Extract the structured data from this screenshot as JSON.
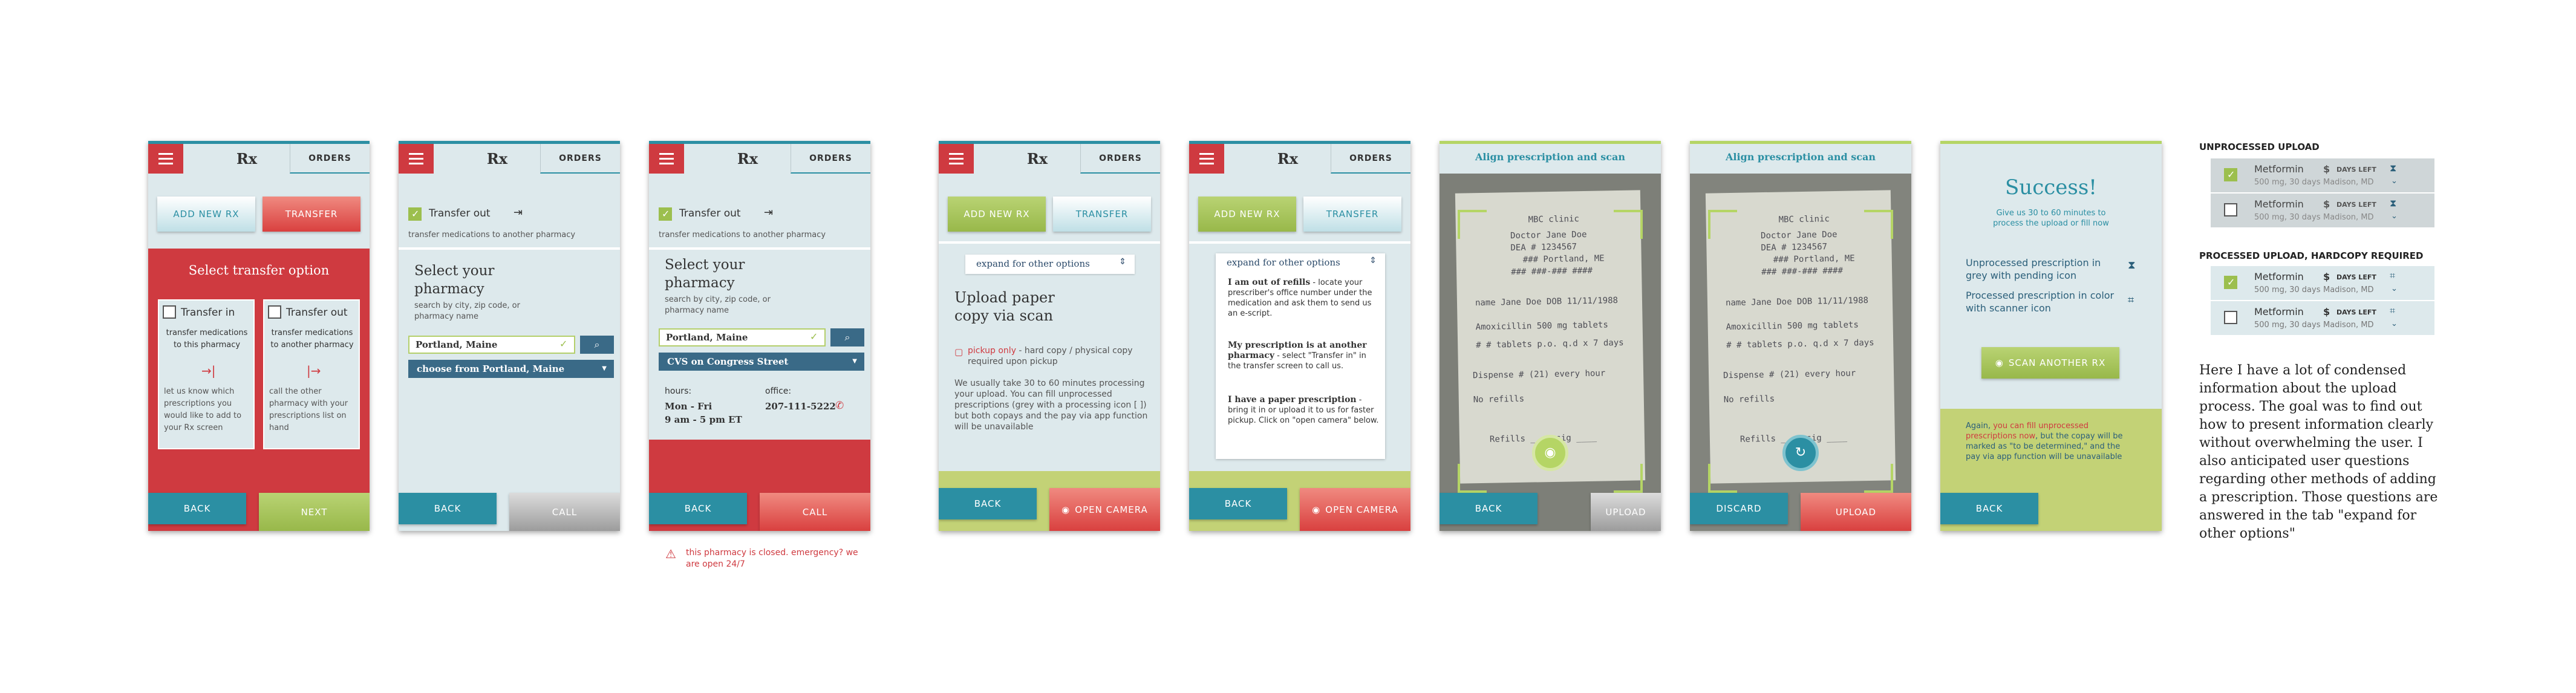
{
  "common": {
    "rx_title": "Rx",
    "orders_tab": "ORDERS"
  },
  "screen1": {
    "add_new_rx": "ADD NEW RX",
    "transfer": "TRANSFER",
    "title": "Select transfer option",
    "in_label": "Transfer in",
    "in_sub": "transfer medications to this pharmacy",
    "in_desc": "let us know which prescriptions you would like to add to your Rx screen",
    "out_label": "Transfer out",
    "out_sub": "transfer medications to another pharmacy",
    "out_desc": "call the other pharmacy with your prescriptions list on hand",
    "back": "BACK",
    "next": "NEXT"
  },
  "screen2": {
    "transfer_out": "Transfer out",
    "sub": "transfer medications to another pharmacy",
    "heading": "Select your pharmacy",
    "hint": "search by city, zip code, or pharmacy name",
    "search_value": "Portland, Maine",
    "choose": "choose from Portland, Maine",
    "back": "BACK",
    "call": "CALL"
  },
  "screen3": {
    "transfer_out": "Transfer out",
    "sub": "transfer medications to another pharmacy",
    "heading": "Select your pharmacy",
    "hint": "search by city, zip code, or pharmacy name",
    "search_value": "Portland, Maine",
    "pharmacy": "CVS on Congress Street",
    "hours_label": "hours:",
    "hours_days": "Mon - Fri",
    "hours_time": "9 am - 5 pm ET",
    "office_label": "office:",
    "office_phone": "207-111-5222",
    "back": "BACK",
    "call": "CALL",
    "warning": "this pharmacy is closed. emergency? we are open 24/7"
  },
  "screen4": {
    "add_new_rx": "ADD NEW RX",
    "transfer": "TRANSFER",
    "expand": "expand for other options",
    "heading": "Upload paper copy via scan",
    "pickup": "pickup only",
    "pickup_desc": " - hard copy / physical copy required upon pickup",
    "body": "We usually take 30 to 60 minutes processing your upload. You can fill unprocessed prescriptions (grey with a processing icon [ ]) but both copays and the pay via app function will be unavailable",
    "back": "BACK",
    "open_camera": "OPEN CAMERA"
  },
  "screen5": {
    "add_new_rx": "ADD NEW RX",
    "transfer": "TRANSFER",
    "expand": "expand for other options",
    "opt1_title": "I am out of refills",
    "opt1_body": " - locate your prescriber's office number under the medication and ask them to send us an e-script.",
    "opt2_title": "My prescription is at another pharmacy",
    "opt2_body": " - select \"Transfer in\" in the transfer screen to call us.",
    "opt3_title": "I have a paper prescription",
    "opt3_body": " - bring it in or upload it to us for faster pickup. Click on \"open camera\" below.",
    "back": "BACK",
    "open_camera": "OPEN CAMERA"
  },
  "screen6": {
    "title": "Align prescription and scan",
    "note_lines": [
      "MBC clinic",
      "Doctor Jane Doe",
      "DEA # 1234567",
      "### Portland, ME",
      "### ###-### ####",
      "name  Jane Doe    DOB 11/11/1988",
      "Amoxicillin 500 mg tablets",
      "# # tablets p.o. q.d x 7 days",
      "Dispense #  (21)  every hour",
      "No refills",
      "Refills ____   sig ____"
    ],
    "back": "BACK",
    "upload": "UPLOAD"
  },
  "screen7": {
    "title": "Align prescription and scan",
    "discard": "DISCARD",
    "upload": "UPLOAD"
  },
  "screen8": {
    "title": "Success!",
    "sub": "Give us 30 to 60 minutes to process the upload or fill now",
    "legend1": "Unprocessed prescription in grey with pending icon",
    "legend2": "Processed prescription in color with scanner icon",
    "scan_another": "SCAN ANOTHER RX",
    "note_pre": "Again, ",
    "note_link": "you can fill unprocessed prescriptions now",
    "note_post": ", but the copay will be marked as \"to be determined,\" and the pay via app function will be unavailable",
    "back": "BACK"
  },
  "list": {
    "unprocessed_title": "UNPROCESSED UPLOAD",
    "processed_title": "PROCESSED UPLOAD, HARDCOPY REQUIRED",
    "rows": [
      {
        "name": "Metformin",
        "dose": "500 mg, 30 days",
        "price": "$",
        "days": "DAYS LEFT",
        "loc": "Madison, MD"
      },
      {
        "name": "Metformin",
        "dose": "500 mg, 30 days",
        "price": "$",
        "days": "DAYS LEFT",
        "loc": "Madison, MD"
      },
      {
        "name": "Metformin",
        "dose": "500 mg, 30 days",
        "price": "$",
        "days": "DAYS LEFT",
        "loc": "Madison, MD"
      },
      {
        "name": "Metformin",
        "dose": "500 mg, 30 days",
        "price": "$",
        "days": "DAYS LEFT",
        "loc": "Madison, MD"
      }
    ]
  },
  "annotation": "Here I have a lot of condensed information about the upload process. The goal was to find out how to present information clearly without overwhelming the user. I also anticipated user questions regarding other methods of adding a prescription. Those questions are answered in the tab \"expand for other options\"",
  "colors": {
    "teal": "#2b8fa3",
    "red": "#cf3a40",
    "green": "#9cbf4e",
    "navy": "#3a6a87",
    "panel": "#dde9ec"
  }
}
